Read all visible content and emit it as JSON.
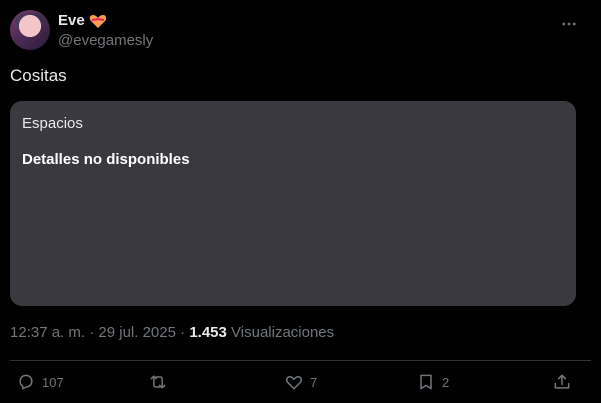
{
  "author": {
    "display_name": "Eve",
    "handle": "@evegamesly",
    "badge_icon": "heart-with-ribbon-icon"
  },
  "tweet": {
    "text": "Cositas"
  },
  "space_card": {
    "label": "Espacios",
    "status": "Detalles no disponibles"
  },
  "meta": {
    "time": "12:37 a. m.",
    "separator": "·",
    "date": "29 jul. 2025",
    "views_count": "1.453",
    "views_label": "Visualizaciones"
  },
  "actions": {
    "replies": "107",
    "retweets": "",
    "likes": "7",
    "bookmarks": "2"
  },
  "colors": {
    "background": "#000000",
    "card": "#3a3940",
    "muted": "#71767b",
    "text": "#e7e9ea"
  }
}
